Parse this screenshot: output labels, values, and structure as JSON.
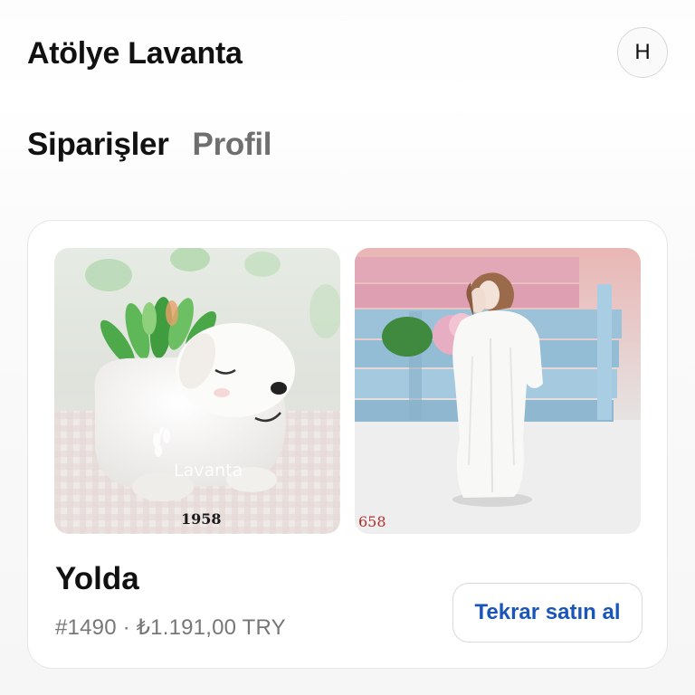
{
  "header": {
    "shop_name": "Atölye Lavanta",
    "avatar_initial": "H"
  },
  "tabs": [
    {
      "label": "Siparişler",
      "active": true
    },
    {
      "label": "Profil",
      "active": false
    }
  ],
  "order": {
    "status": "Yolda",
    "number": "#1490",
    "separator": "·",
    "total": "₺1.191,00 TRY",
    "rebuy_label": "Tekrar satın al",
    "products": [
      {
        "image_icon": "puppy-planter-photo",
        "watermark": "Lavanta",
        "code": "1958"
      },
      {
        "image_icon": "couple-figurine-photo",
        "code": "658"
      }
    ]
  },
  "colors": {
    "accent": "#1a56b8",
    "muted_text": "#777777",
    "card_border": "#e6e6e6"
  }
}
